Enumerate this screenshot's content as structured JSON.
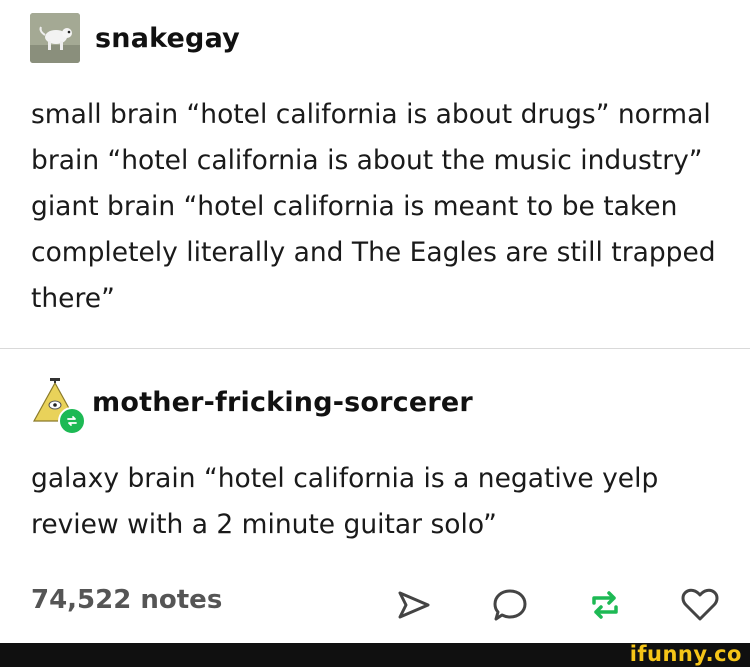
{
  "posts": [
    {
      "username": "snakegay",
      "text": "small brain “hotel california is about drugs” normal brain “hotel california is about the music industry” giant brain “hotel california is meant to be taken completely literally and The Eagles are still trapped there”"
    },
    {
      "username": "mother-fricking-sorcerer",
      "text": "galaxy brain “hotel california is a negative yelp review with a 2 minute guitar solo”"
    }
  ],
  "footer": {
    "notes": "74,522 notes",
    "actions": [
      "share-icon",
      "reply-icon",
      "reblog-icon",
      "like-icon"
    ],
    "colors": {
      "reblog": "#1db954",
      "icon": "#444444"
    }
  },
  "watermark": "ifunny.co"
}
